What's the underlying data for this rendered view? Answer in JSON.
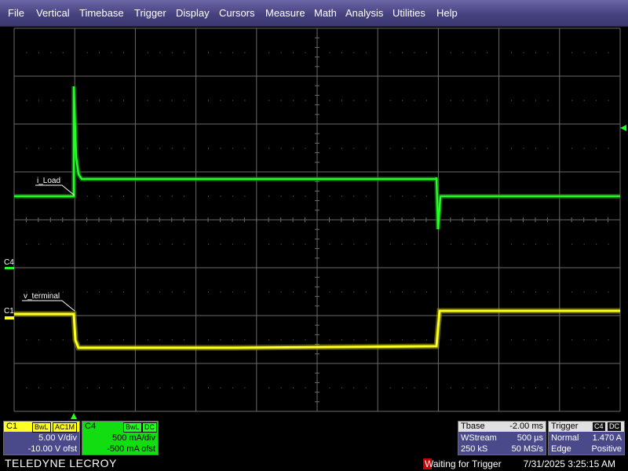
{
  "menu": [
    "File",
    "Vertical",
    "Timebase",
    "Trigger",
    "Display",
    "Cursors",
    "Measure",
    "Math",
    "Analysis",
    "Utilities",
    "Help"
  ],
  "colors": {
    "menu_bg": "#4c4887",
    "ch1": "#ffff22",
    "ch4": "#22ff22",
    "grid": "#6a6a6a",
    "waiting": "#cc0000"
  },
  "waveform": {
    "c4_marker": "C4",
    "c1_marker": "C1",
    "c4_label": "i_Load",
    "c1_label": "v_terminal"
  },
  "ch1": {
    "name": "C1",
    "bwl": "BwL",
    "coupling": "AC1M",
    "scale": "5.00 V/div",
    "offset": "-10.00 V ofst"
  },
  "ch4": {
    "name": "C4",
    "bwl": "BwL",
    "coupling": "DC",
    "scale": "500 mA/div",
    "offset": "-500 mA ofst"
  },
  "timebase": {
    "title": "Tbase",
    "delay": "-2.00 ms",
    "mode": "WStream",
    "time_div": "500 µs",
    "samples": "250 kS",
    "rate": "50 MS/s"
  },
  "trigger": {
    "title": "Trigger",
    "source": "C4",
    "coupling": "DC",
    "mode": "Normal",
    "level": "1.470 A",
    "type": "Edge",
    "slope": "Positive"
  },
  "brand": "TELEDYNE LECROY",
  "status": {
    "message": "Waiting for Trigger",
    "datetime": "7/31/2025 3:25:15 AM"
  }
}
